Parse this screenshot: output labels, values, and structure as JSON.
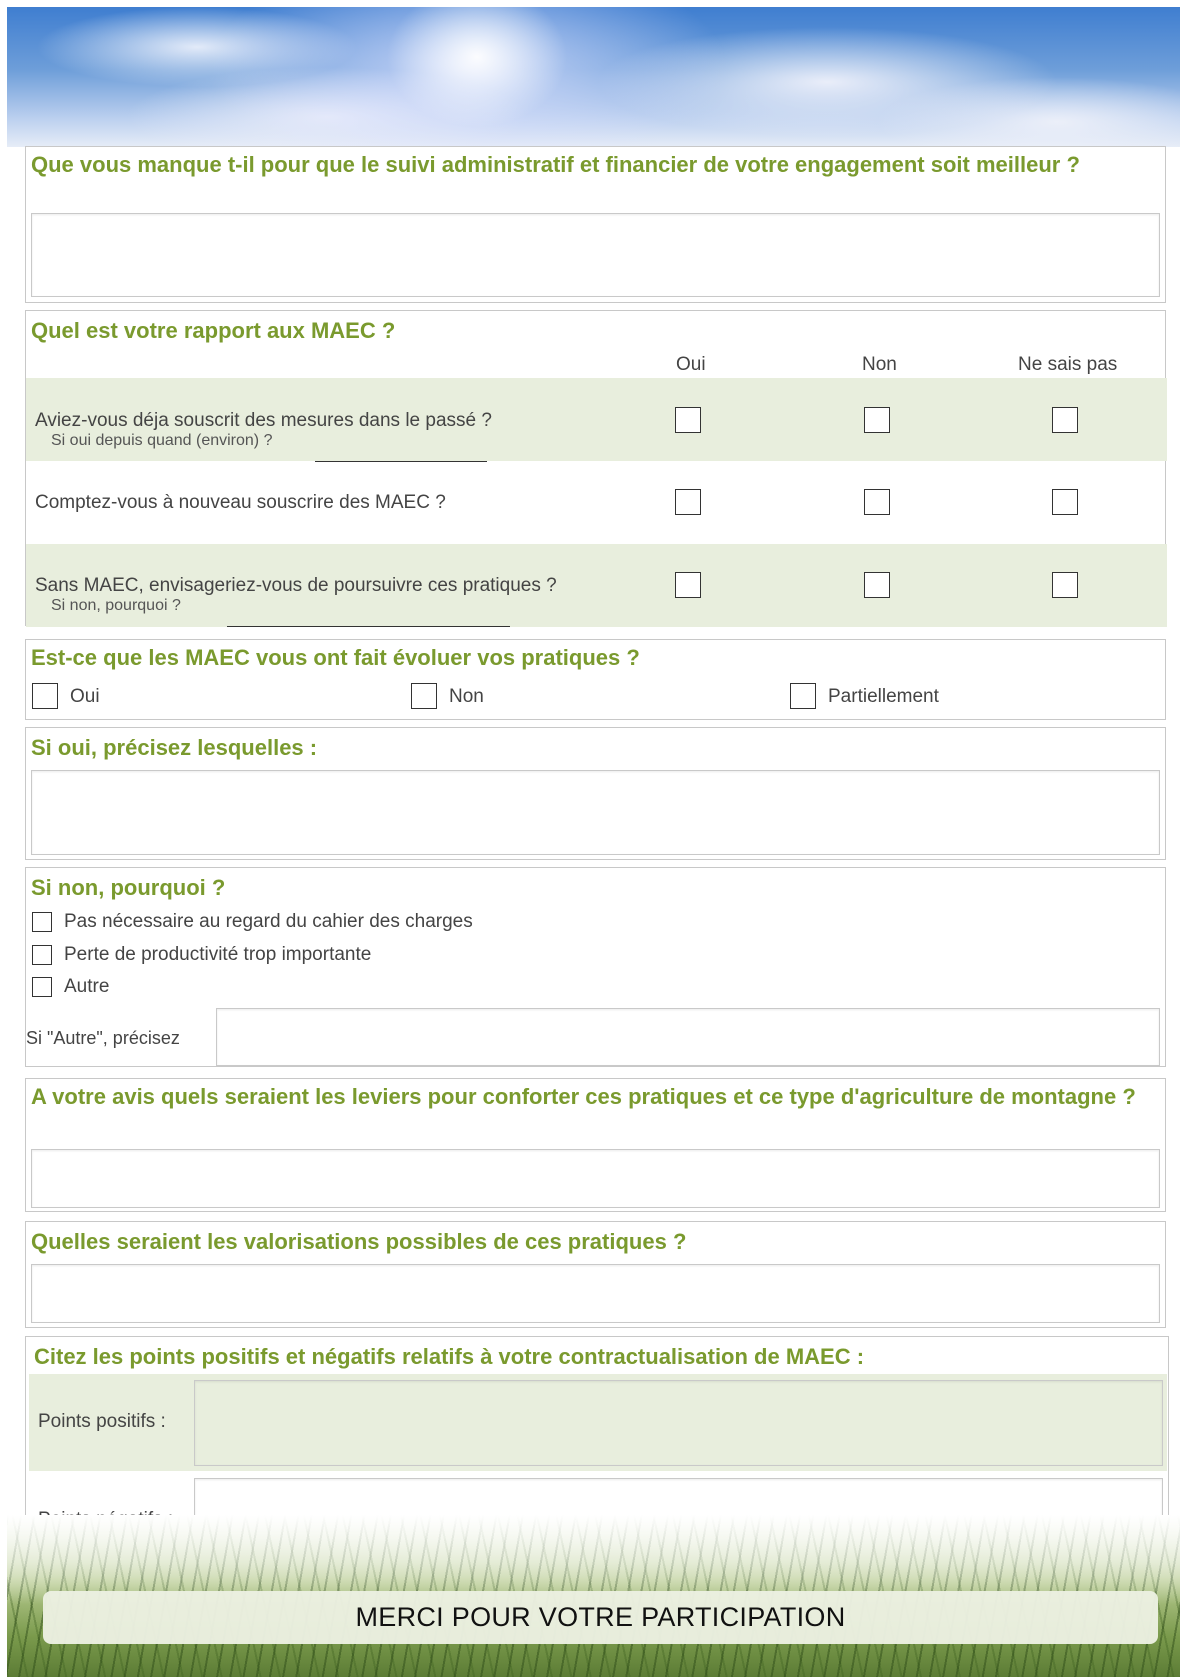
{
  "q1": {
    "title": "Que vous manque t-il pour que le suivi administratif et financier de votre engagement soit meilleur ?"
  },
  "q2": {
    "title": "Quel est votre rapport aux MAEC ?",
    "columns": [
      "Oui",
      "Non",
      "Ne sais pas"
    ],
    "rows": [
      {
        "label": "Aviez-vous déja souscrit des mesures dans le passé ?",
        "sublabel": "Si oui depuis quand (environ) ?"
      },
      {
        "label": "Comptez-vous à nouveau souscrire des MAEC ?",
        "sublabel": ""
      },
      {
        "label": "Sans MAEC, envisageriez-vous de poursuivre ces pratiques ?",
        "sublabel": "Si non, pourquoi ?"
      }
    ]
  },
  "q3": {
    "title": "Est-ce que les MAEC vous ont fait évoluer vos pratiques ?",
    "options": [
      "Oui",
      "Non",
      "Partiellement"
    ]
  },
  "q4": {
    "title": "Si oui, précisez lesquelles :"
  },
  "q5": {
    "title": "Si non, pourquoi ?",
    "options": [
      "Pas nécessaire au regard du cahier des charges",
      "Perte de productivité trop importante",
      "Autre"
    ],
    "other_label": "Si \"Autre\", précisez"
  },
  "q6": {
    "title": "A votre avis quels seraient les leviers pour conforter ces pratiques et ce type d'agriculture de montagne ?"
  },
  "q7": {
    "title": "Quelles seraient les valorisations possibles de ces pratiques ?"
  },
  "q8": {
    "title": "Citez les points positifs et négatifs relatifs à votre contractualisation de MAEC :",
    "positive_label": "Points positifs :",
    "negative_label": "Points négatifs :"
  },
  "footer": {
    "thanks": "MERCI POUR VOTRE PARTICIPATION"
  },
  "colors": {
    "accent": "#7a9a2e",
    "band": "#e8eedd"
  }
}
